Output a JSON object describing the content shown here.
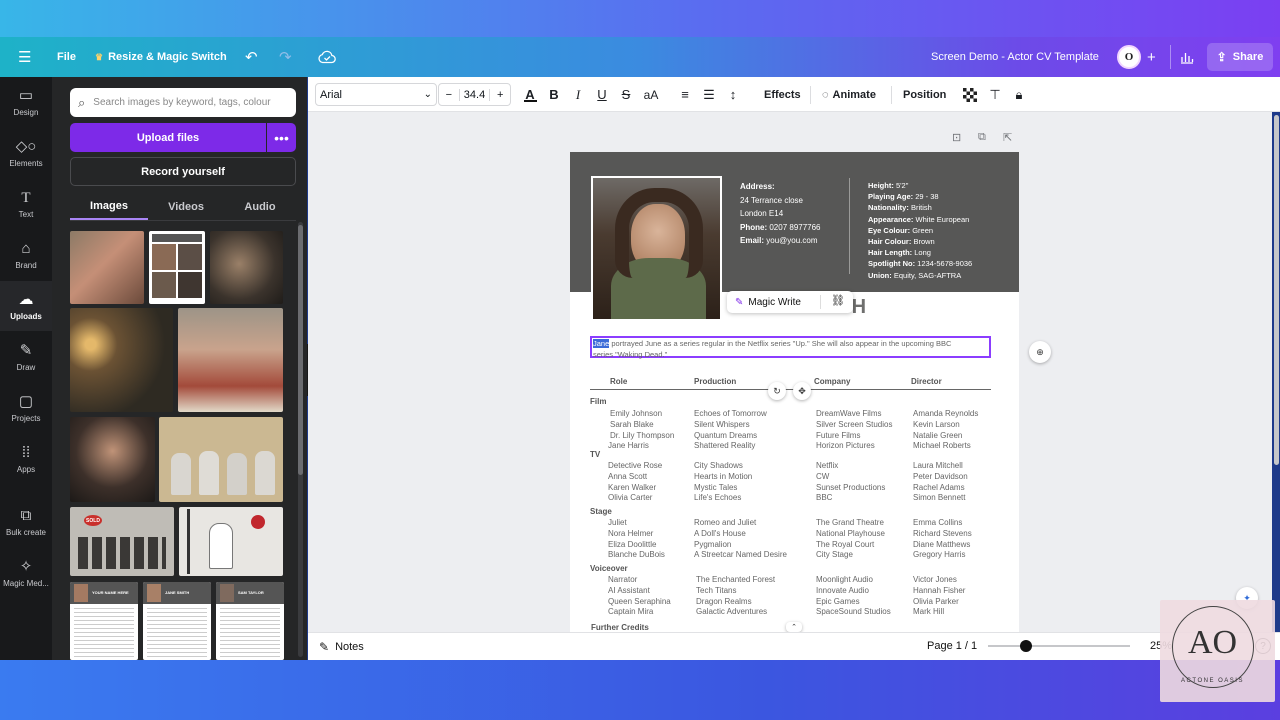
{
  "topbar": {
    "file_label": "File",
    "resize_label": "Resize & Magic Switch",
    "doc_title": "Screen Demo - Actor CV Template",
    "share_label": "Share",
    "avatar_initial": "O"
  },
  "sidebar": {
    "items": [
      {
        "label": "Design"
      },
      {
        "label": "Elements"
      },
      {
        "label": "Text"
      },
      {
        "label": "Brand"
      },
      {
        "label": "Uploads"
      },
      {
        "label": "Draw"
      },
      {
        "label": "Projects"
      },
      {
        "label": "Apps"
      },
      {
        "label": "Bulk create"
      },
      {
        "label": "Magic Med..."
      }
    ]
  },
  "panel": {
    "search_placeholder": "Search images by keyword, tags, colour",
    "upload_label": "Upload files",
    "record_label": "Record yourself",
    "tabs": [
      {
        "label": "Images"
      },
      {
        "label": "Videos"
      },
      {
        "label": "Audio"
      }
    ],
    "badge_sold": "SOLD",
    "template_names": [
      "YOUR NAME HERE",
      "JANE SMITH",
      "SAM TAYLOR"
    ]
  },
  "toolbar": {
    "font": "Arial",
    "font_size": "34.4",
    "effects_label": "Effects",
    "animate_label": "Animate",
    "position_label": "Position"
  },
  "cv": {
    "name": "JANE SMITH",
    "address_label": "Address:",
    "address_lines": [
      "24 Terrance close",
      "London E14"
    ],
    "phone_label": "Phone:",
    "phone": "0207 8977766",
    "email_label": "Email:",
    "email": "you@you.com",
    "attrs": [
      {
        "label": "Height:",
        "value": "5'2\""
      },
      {
        "label": "Playing Age:",
        "value": "29 - 38"
      },
      {
        "label": "Nationality:",
        "value": "British"
      },
      {
        "label": "Appearance:",
        "value": "White European"
      },
      {
        "label": "Eye Colour:",
        "value": "Green"
      },
      {
        "label": "Hair Colour:",
        "value": "Brown"
      },
      {
        "label": "Hair Length:",
        "value": "Long"
      },
      {
        "label": "Spotlight No:",
        "value": "1234-5678-9036"
      },
      {
        "label": "Union:",
        "value": "Equity, SAG-AFTRA"
      }
    ],
    "bio_highlight": "Jane",
    "bio_line1": " portrayed June as a series regular in the Netflix series \"Up.\" She will also appear in the upcoming BBC",
    "bio_line2": "series \"Waking Dead.\"",
    "headers": {
      "role": "Role",
      "production": "Production",
      "company": "Company",
      "director": "Director"
    },
    "sections": [
      {
        "title": "Film",
        "rows": [
          [
            "Emily Johnson",
            "Echoes of Tomorrow",
            "DreamWave Films",
            "Amanda Reynolds"
          ],
          [
            "Sarah Blake",
            "Silent Whispers",
            "Silver Screen Studios",
            "Kevin Larson"
          ],
          [
            "Dr. Lily Thompson",
            "Quantum Dreams",
            "Future Films",
            "Natalie Green"
          ],
          [
            "Jane Harris",
            "Shattered Reality",
            "Horizon Pictures",
            "Michael Roberts"
          ]
        ]
      },
      {
        "title": "TV",
        "rows": [
          [
            "Detective Rose",
            "City Shadows",
            "Netflix",
            "Laura Mitchell"
          ],
          [
            "Anna Scott",
            "Hearts in Motion",
            "CW",
            "Peter Davidson"
          ],
          [
            "Karen Walker",
            "Mystic Tales",
            "Sunset Productions",
            "Rachel Adams"
          ],
          [
            "Olivia Carter",
            "Life's Echoes",
            "BBC",
            "Simon Bennett"
          ]
        ]
      },
      {
        "title": "Stage",
        "rows": [
          [
            "Juliet",
            "Romeo and Juliet",
            "The Grand Theatre",
            "Emma Collins"
          ],
          [
            "Nora Helmer",
            "A Doll's House",
            "National Playhouse",
            "Richard Stevens"
          ],
          [
            "Eliza Doolittle",
            "Pygmalion",
            "The Royal Court",
            "Diane Matthews"
          ],
          [
            "Blanche DuBois",
            "A Streetcar Named Desire",
            "City Stage",
            "Gregory Harris"
          ]
        ]
      },
      {
        "title": "Voiceover",
        "rows": [
          [
            "Narrator",
            "The Enchanted Forest",
            "Moonlight Audio",
            "Victor Jones"
          ],
          [
            "AI Assistant",
            "Tech Titans",
            "Innovate Audio",
            "Hannah Fisher"
          ],
          [
            "Queen Seraphina",
            "Dragon Realms",
            "Epic Games",
            "Olivia Parker"
          ],
          [
            "Captain Mira",
            "Galactic Adventures",
            "SpaceSound Studios",
            "Mark Hill"
          ]
        ]
      }
    ],
    "further_credits": "Further Credits"
  },
  "magic_write_label": "Magic Write",
  "footer": {
    "notes_label": "Notes",
    "page_label": "Page 1 / 1",
    "zoom": "25%"
  },
  "watermark": {
    "monogram": "AO",
    "text": "ACTONE OASIS"
  }
}
